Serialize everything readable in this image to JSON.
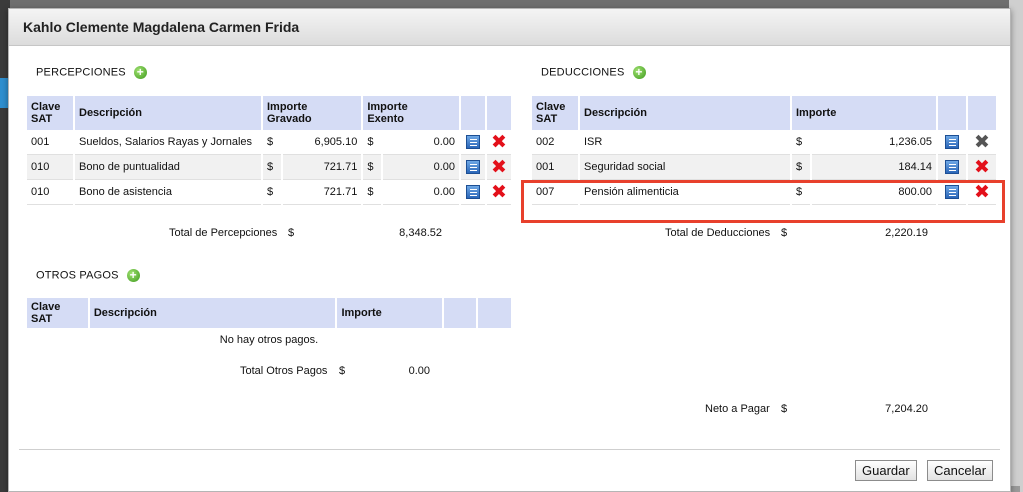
{
  "dialog": {
    "title": "Kahlo Clemente Magdalena Carmen Frida",
    "save_label": "Guardar",
    "cancel_label": "Cancelar"
  },
  "percepciones": {
    "label": "PERCEPCIONES",
    "headers": {
      "clave_line1": "Clave",
      "clave_line2": "SAT",
      "descripcion": "Descripción",
      "gravado_line1": "Importe",
      "gravado_line2": "Gravado",
      "exento_line1": "Importe",
      "exento_line2": "Exento"
    },
    "rows": [
      {
        "clave": "001",
        "descripcion": "Sueldos, Salarios Rayas y Jornales",
        "cur1": "$",
        "gravado": "6,905.10",
        "cur2": "$",
        "exento": "0.00"
      },
      {
        "clave": "010",
        "descripcion": "Bono de puntualidad",
        "cur1": "$",
        "gravado": "721.71",
        "cur2": "$",
        "exento": "0.00"
      },
      {
        "clave": "010",
        "descripcion": "Bono de asistencia",
        "cur1": "$",
        "gravado": "721.71",
        "cur2": "$",
        "exento": "0.00"
      }
    ],
    "total_label": "Total de Percepciones",
    "total_currency": "$",
    "total_value": "8,348.52"
  },
  "otros_pagos": {
    "label": "OTROS PAGOS",
    "headers": {
      "clave": "Clave SAT",
      "descripcion": "Descripción",
      "importe": "Importe"
    },
    "empty_message": "No hay otros pagos.",
    "total_label": "Total Otros Pagos",
    "total_currency": "$",
    "total_value": "0.00"
  },
  "deducciones": {
    "label": "DEDUCCIONES",
    "headers": {
      "clave_line1": "Clave",
      "clave_line2": "SAT",
      "descripcion": "Descripción",
      "importe": "Importe"
    },
    "rows": [
      {
        "clave": "002",
        "descripcion": "ISR",
        "cur": "$",
        "importe": "1,236.05",
        "delete_icon": "gray-x-icon"
      },
      {
        "clave": "001",
        "descripcion": "Seguridad social",
        "cur": "$",
        "importe": "184.14",
        "delete_icon": "red-x-icon"
      },
      {
        "clave": "007",
        "descripcion": "Pensión alimenticia",
        "cur": "$",
        "importe": "800.00",
        "delete_icon": "red-x-icon"
      }
    ],
    "total_label": "Total de Deducciones",
    "total_currency": "$",
    "total_value": "2,220.19"
  },
  "neto": {
    "label": "Neto a Pagar",
    "currency": "$",
    "value": "7,204.20"
  },
  "colors": {
    "header_bg": "#d5dcf5",
    "highlight": "#e8402c",
    "delete_red": "#e3101a",
    "add_green": "#3e9a1e"
  }
}
